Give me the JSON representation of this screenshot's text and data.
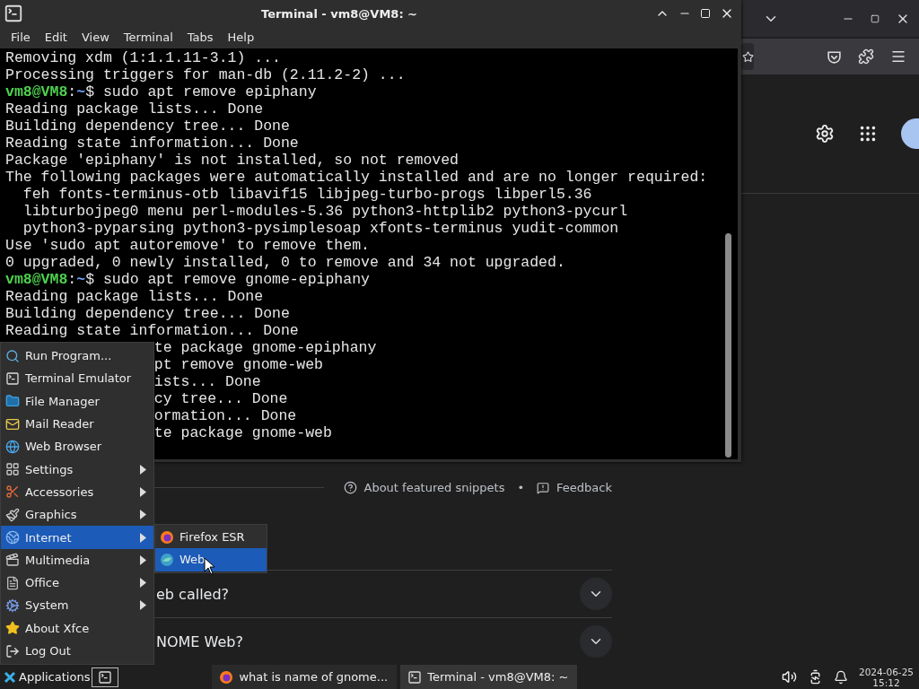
{
  "browser": {
    "snippet_links": {
      "about": "About featured snippets",
      "separator": "•",
      "feedback": "Feedback"
    },
    "questions": [
      {
        "text": "eb called?"
      },
      {
        "text": "NOME Web?"
      }
    ]
  },
  "terminal": {
    "title": "Terminal - vm8@VM8: ~",
    "menu": [
      "File",
      "Edit",
      "View",
      "Terminal",
      "Tabs",
      "Help"
    ],
    "lines": [
      {
        "kind": "output",
        "text": "Removing xdm (1:1.1.11-3.1) ..."
      },
      {
        "kind": "output",
        "text": "Processing triggers for man-db (2.11.2-2) ..."
      },
      {
        "kind": "prompt",
        "user": "vm8@VM8",
        "colon": ":",
        "path": "~",
        "command": "$ sudo apt remove epiphany"
      },
      {
        "kind": "output",
        "text": "Reading package lists... Done"
      },
      {
        "kind": "output",
        "text": "Building dependency tree... Done"
      },
      {
        "kind": "output",
        "text": "Reading state information... Done"
      },
      {
        "kind": "output",
        "text": "Package 'epiphany' is not installed, so not removed"
      },
      {
        "kind": "output",
        "text": "The following packages were automatically installed and are no longer required:"
      },
      {
        "kind": "output",
        "text": "  feh fonts-terminus-otb libavif15 libjpeg-turbo-progs libperl5.36"
      },
      {
        "kind": "output",
        "text": "  libturbojpeg0 menu perl-modules-5.36 python3-httplib2 python3-pycurl"
      },
      {
        "kind": "output",
        "text": "  python3-pyparsing python3-pysimplesoap xfonts-terminus yudit-common"
      },
      {
        "kind": "output",
        "text": "Use 'sudo apt autoremove' to remove them."
      },
      {
        "kind": "output",
        "text": "0 upgraded, 0 newly installed, 0 to remove and 34 not upgraded."
      },
      {
        "kind": "prompt",
        "user": "vm8@VM8",
        "colon": ":",
        "path": "~",
        "command": "$ sudo apt remove gnome-epiphany"
      },
      {
        "kind": "output",
        "text": "Reading package lists... Done"
      },
      {
        "kind": "output",
        "text": "Building dependency tree... Done"
      },
      {
        "kind": "output",
        "text": "Reading state information... Done"
      },
      {
        "kind": "partial",
        "text": "te package gnome-epiphany"
      },
      {
        "kind": "partial",
        "text": "pt remove gnome-web"
      },
      {
        "kind": "partial",
        "text": "ists... Done"
      },
      {
        "kind": "partial",
        "text": "cy tree... Done"
      },
      {
        "kind": "partial",
        "text": "ormation... Done"
      },
      {
        "kind": "partial",
        "text": "te package gnome-web"
      }
    ]
  },
  "app_menu": {
    "items": [
      {
        "label": "Run Program...",
        "kind": "run",
        "submenu": false,
        "selected": false
      },
      {
        "label": "Terminal Emulator",
        "kind": "terminal",
        "submenu": false,
        "selected": false
      },
      {
        "label": "File Manager",
        "kind": "files",
        "submenu": false,
        "selected": false
      },
      {
        "label": "Mail Reader",
        "kind": "mail",
        "submenu": false,
        "selected": false
      },
      {
        "label": "Web Browser",
        "kind": "web",
        "submenu": false,
        "selected": false
      },
      {
        "label": "Settings",
        "kind": "settings",
        "submenu": true,
        "selected": false
      },
      {
        "label": "Accessories",
        "kind": "accessories",
        "submenu": true,
        "selected": false
      },
      {
        "label": "Graphics",
        "kind": "graphics",
        "submenu": true,
        "selected": false
      },
      {
        "label": "Internet",
        "kind": "internet",
        "submenu": true,
        "selected": true
      },
      {
        "label": "Multimedia",
        "kind": "multimedia",
        "submenu": true,
        "selected": false
      },
      {
        "label": "Office",
        "kind": "office",
        "submenu": true,
        "selected": false
      },
      {
        "label": "System",
        "kind": "system",
        "submenu": true,
        "selected": false
      },
      {
        "label": "About Xfce",
        "kind": "about",
        "submenu": false,
        "selected": false
      },
      {
        "label": "Log Out",
        "kind": "logout",
        "submenu": false,
        "selected": false
      }
    ],
    "submenu": [
      {
        "label": "Firefox ESR",
        "kind": "firefox",
        "selected": false
      },
      {
        "label": "Web",
        "kind": "epiphany",
        "selected": true
      }
    ]
  },
  "taskbar": {
    "applications": "Applications",
    "tasks": [
      {
        "label": "what is name of gnome...",
        "kind": "firefox",
        "selected": false
      },
      {
        "label": "Terminal - vm8@VM8: ~",
        "kind": "terminal",
        "selected": true
      }
    ],
    "date": "2024-06-25",
    "time": "15:12"
  }
}
